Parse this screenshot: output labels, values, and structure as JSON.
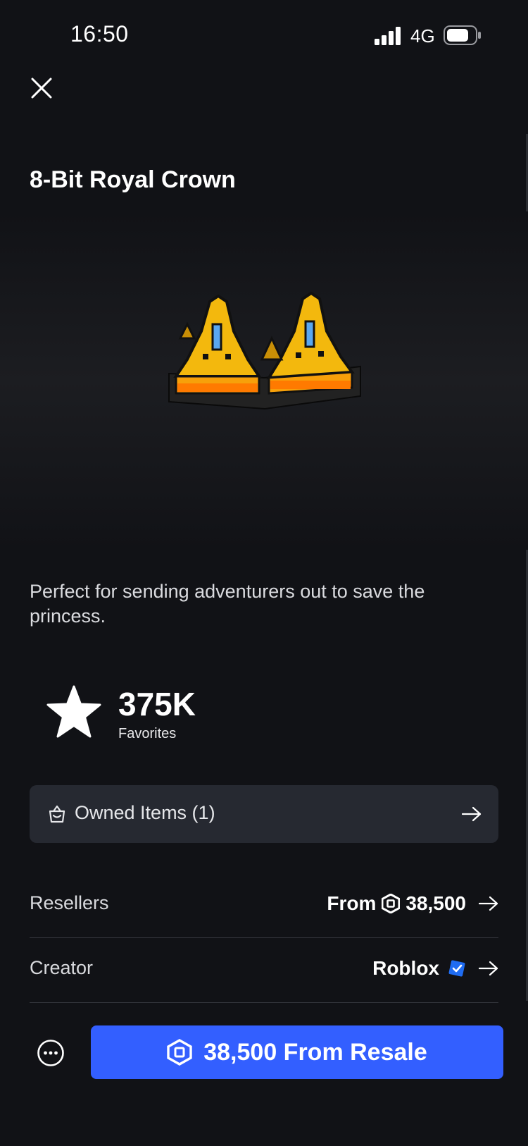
{
  "status_bar": {
    "time": "16:50",
    "network": "4G"
  },
  "item": {
    "title": "8-Bit Royal Crown",
    "description": "Perfect for sending adventurers out to save the princess."
  },
  "favorites": {
    "count": "375K",
    "label": "Favorites"
  },
  "owned_items": {
    "label": "Owned Items (1)"
  },
  "resellers": {
    "label": "Resellers",
    "prefix": "From",
    "price": "38,500"
  },
  "creator": {
    "label": "Creator",
    "name": "Roblox"
  },
  "buy_button": {
    "label": "38,500 From Resale"
  },
  "colors": {
    "background": "#111216",
    "accent": "#335fff",
    "card": "#262931",
    "verified": "#1f6cf2"
  },
  "icons": [
    "close-icon",
    "signal-icon",
    "battery-icon",
    "star-icon",
    "shopping-bag-icon",
    "arrow-right-icon",
    "robux-icon",
    "verified-badge-icon",
    "more-icon"
  ]
}
